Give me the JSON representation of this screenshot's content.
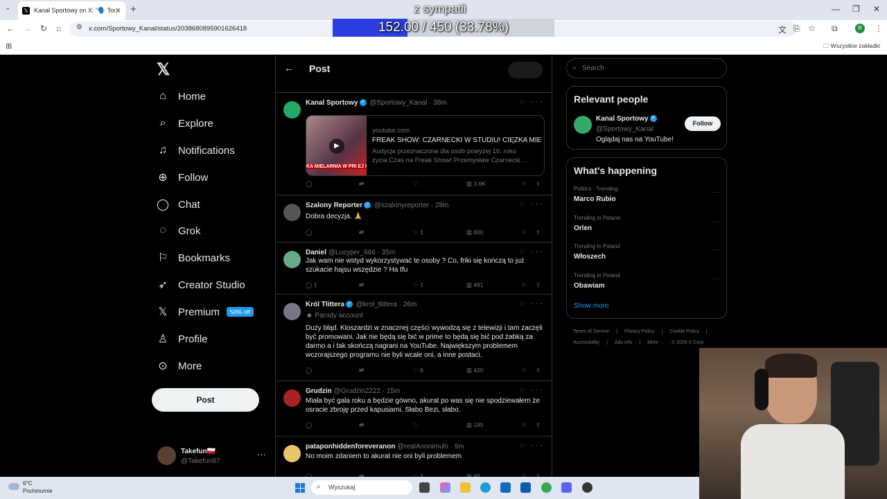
{
  "browser": {
    "tab_title": "Kanal Sportowy on X: \"🗣️ Tom",
    "url": "x.com/Sportowy_Kanal/status/2038680895901626418",
    "bookmarks_label": "Wszystkie zakładki",
    "profile_initial": "R"
  },
  "overlay": {
    "title": "z sympatii",
    "progress_text": "152.00 / 450 (33.78%)",
    "progress_fraction": 0.3378
  },
  "nav": {
    "items": [
      {
        "label": "Home",
        "icon": "home-icon"
      },
      {
        "label": "Explore",
        "icon": "search-icon"
      },
      {
        "label": "Notifications",
        "icon": "bell-icon"
      },
      {
        "label": "Follow",
        "icon": "add-person-icon"
      },
      {
        "label": "Chat",
        "icon": "chat-icon"
      },
      {
        "label": "Grok",
        "icon": "grok-icon"
      },
      {
        "label": "Bookmarks",
        "icon": "bookmark-icon"
      },
      {
        "label": "Creator Studio",
        "icon": "rocket-icon"
      },
      {
        "label": "Premium",
        "icon": "x-icon"
      },
      {
        "label": "Profile",
        "icon": "person-icon"
      },
      {
        "label": "More",
        "icon": "more-circle-icon"
      }
    ],
    "premium_badge": "50% off",
    "post_button": "Post",
    "account": {
      "name": "Takefun🇵🇱",
      "handle": "@Takefun97"
    }
  },
  "header": {
    "title": "Post"
  },
  "tweets": [
    {
      "name": "Kanal Sportowy",
      "verified": true,
      "handle": "@Sportowy_Kanal",
      "time": "· 38m",
      "card": {
        "domain": "youtube.com",
        "title": "FREAK SHOW: CZARNECKI W STUDIU! CIĘŻKA MIE...",
        "desc": "Audycja przeznaczona dla osób powyżej 16. roku życia.Czas na Freak Show! Przemysław Czarnecki ...",
        "thumb_text": "KA MIELARNIA W PRI EJ KLOSZARDÓW - PRZES"
      },
      "replies": "",
      "reposts": "",
      "likes": "",
      "views": "3.6K"
    },
    {
      "name": "Szalony Reporter",
      "verified": true,
      "handle": "@szalonyreporter",
      "time": "· 28m",
      "text": "Dobra decyzja. 🙏",
      "replies": "",
      "reposts": "",
      "likes": "1",
      "views": "600"
    },
    {
      "name": "Daniel",
      "verified": false,
      "handle": "@Lucyper_666",
      "time": "· 35m",
      "text": "Jak wam nie wstyd wykorzystywać te osoby ? Co, friki się kończą to już szukacie hajsu wszędzie ? Ha tfu",
      "replies": "1",
      "reposts": "",
      "likes": "1",
      "views": "481"
    },
    {
      "name": "Król Tlittera",
      "verified": true,
      "handle": "@krol_tlittera",
      "time": "· 26m",
      "parody": "Parody account",
      "text": "Duży błąd. Kloszardzi w znacznej części wywodzą się z telewizji i tam zaczęli być promowani. Jak nie będą się bić w prime to będą się bić pod żabką za darmo a i tak skończą nagrani na YouTube.  Największym problemem wczorajszego programu nie byli wcale oni, a inne postaci.",
      "replies": "",
      "reposts": "",
      "likes": "6",
      "views": "420"
    },
    {
      "name": "Grudzin",
      "verified": false,
      "handle": "@Grudzin2222",
      "time": "· 15m",
      "text": "Miała być gala roku a będzie gówno, akurat po was się nie spodziewałem że osracie zbroję przed kapusiami. Słabo Bezi, słabo.",
      "replies": "",
      "reposts": "",
      "likes": "",
      "views": "195"
    },
    {
      "name": "pataponhiddenforeveranon",
      "verified": false,
      "handle": "@realAnonimuls",
      "time": "· 9m",
      "text": "No moim zdaniem to akurat nie oni byli problemem",
      "replies": "",
      "reposts": "",
      "likes": "2",
      "views": "90"
    }
  ],
  "right": {
    "search_placeholder": "Search",
    "relevant_title": "Relevant people",
    "relevant": {
      "name": "Kanal Sportowy",
      "handle": "@Sportowy_Kanal",
      "bio": "Oglądaj nas na YouTube!",
      "follow": "Follow"
    },
    "happening_title": "What's happening",
    "trends": [
      {
        "meta": "Politics · Trending",
        "topic": "Marco Rubio"
      },
      {
        "meta": "Trending in Poland",
        "topic": "Orlen"
      },
      {
        "meta": "Trending in Poland",
        "topic": "Włoszech"
      },
      {
        "meta": "Trending in Poland",
        "topic": "Obawiam"
      }
    ],
    "show_more": "Show more",
    "footer1": [
      "Terms of Service",
      "|",
      "Privacy Policy",
      "|",
      "Cookie Policy",
      "|"
    ],
    "footer2": [
      "Accessibility",
      "|",
      "Ads info",
      "|",
      "More ···",
      "© 2026 X Corp."
    ]
  },
  "taskbar": {
    "temp": "6°C",
    "weather": "Pochmurnie",
    "search_placeholder": "Wyszukaj"
  }
}
